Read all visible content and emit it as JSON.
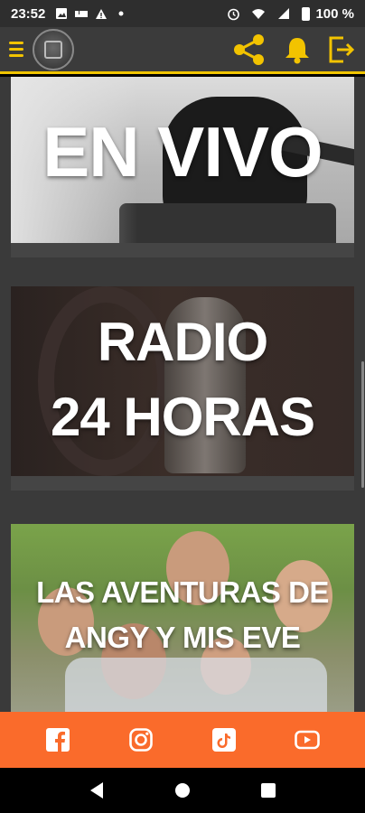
{
  "status_bar": {
    "time": "23:52",
    "battery": "100 %",
    "icons": [
      "gallery-icon",
      "bed-icon",
      "warning-icon",
      "dot-icon",
      "alarm-icon",
      "wifi-icon",
      "signal-icon",
      "battery-icon"
    ]
  },
  "app_bar": {
    "logo_name": "app-logo",
    "actions": [
      "share-icon",
      "bell-icon",
      "exit-icon"
    ],
    "accent_color": "#f2c300"
  },
  "cards": [
    {
      "title_line1": "EN VIVO"
    },
    {
      "title_line1": "RADIO",
      "title_line2": "24 HORAS"
    },
    {
      "title_line1": "LAS AVENTURAS DE",
      "title_line2": "ANGY Y MIS EVE"
    }
  ],
  "social_bar": {
    "color": "#fa6b2b",
    "buttons": [
      "facebook-icon",
      "instagram-icon",
      "tiktok-icon",
      "youtube-icon"
    ]
  },
  "nav_bar": {
    "buttons": [
      "back-icon",
      "home-icon",
      "recents-icon"
    ]
  }
}
